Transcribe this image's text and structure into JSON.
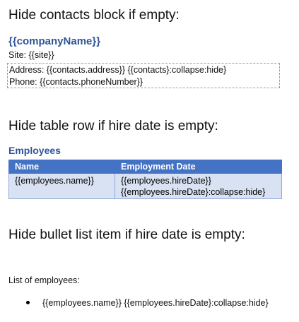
{
  "contacts_section": {
    "heading": "Hide contacts block if empty:",
    "company_name": "{{companyName}}",
    "site_line": "Site: {{site}}",
    "address_line": "Address: {{contacts.address}} {{contacts}:collapse:hide}",
    "phone_line": "Phone: {{contacts.phoneNumber}}"
  },
  "table_section": {
    "heading": "Hide table row if hire date is empty:",
    "title": "Employees",
    "columns": [
      "Name",
      "Employment Date"
    ],
    "rows": [
      {
        "name": "{{employees.name}}",
        "date_line_1": "{{employees.hireDate}}",
        "date_line_2": "{{employees.hireDate}:collapse:hide}"
      }
    ]
  },
  "list_section": {
    "heading": "Hide bullet list item if hire date is empty:",
    "intro": "List of employees:",
    "items": [
      "{{employees.name}} {{employees.hireDate}:collapse:hide}"
    ]
  },
  "colors": {
    "accent": "#2f5597",
    "table_header": "#4472c4",
    "table_row": "#d9e2f3"
  }
}
